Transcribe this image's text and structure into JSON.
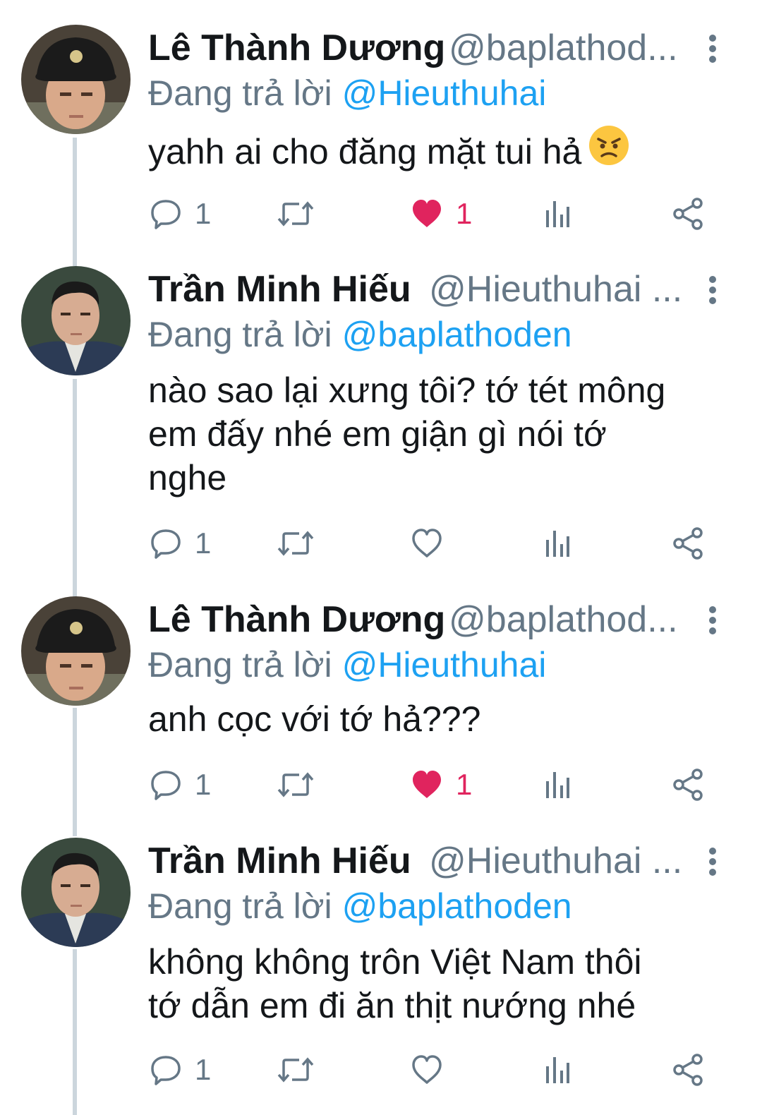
{
  "tweets": [
    {
      "name": "Lê Thành Dương",
      "handle": "@baplathod...",
      "replying_prefix": "Đang trả lời ",
      "replying_to": "@Hieuthuhai",
      "lines": [
        "yahh ai cho đăng mặt tui hả"
      ],
      "emoji": "angry-face-emoji",
      "replies": "1",
      "likes": "1",
      "liked": true,
      "avatar": "avatar-le-thanh-duong"
    },
    {
      "name": "Trần Minh Hiếu",
      "handle": "@Hieuthuhai ...",
      "replying_prefix": "Đang trả lời ",
      "replying_to": "@baplathoden",
      "lines": [
        "nào sao lại xưng tôi? tớ tét mông",
        "em đấy nhé em giận gì nói tớ",
        "nghe"
      ],
      "replies": "1",
      "likes": "",
      "liked": false,
      "avatar": "avatar-tran-minh-hieu"
    },
    {
      "name": "Lê Thành Dương",
      "handle": "@baplathod...",
      "replying_prefix": "Đang trả lời ",
      "replying_to": "@Hieuthuhai",
      "lines": [
        "anh cọc với tớ hả???"
      ],
      "replies": "1",
      "likes": "1",
      "liked": true,
      "avatar": "avatar-le-thanh-duong"
    },
    {
      "name": "Trần Minh Hiếu",
      "handle": "@Hieuthuhai ...",
      "replying_prefix": "Đang trả lời ",
      "replying_to": "@baplathoden",
      "lines": [
        "không không trôn Việt Nam thôi",
        "tớ dẫn em đi ăn thịt nướng nhé"
      ],
      "replies": "1",
      "likes": "",
      "liked": false,
      "avatar": "avatar-tran-minh-hieu"
    }
  ],
  "colors": {
    "text": "#14171a",
    "secondary": "#657786",
    "mention": "#1da1f2",
    "like": "#e0245e",
    "thread_line": "#ccd6dd"
  },
  "icons": [
    "reply-icon",
    "retweet-icon",
    "like-icon",
    "analytics-icon",
    "share-icon",
    "more-icon"
  ]
}
